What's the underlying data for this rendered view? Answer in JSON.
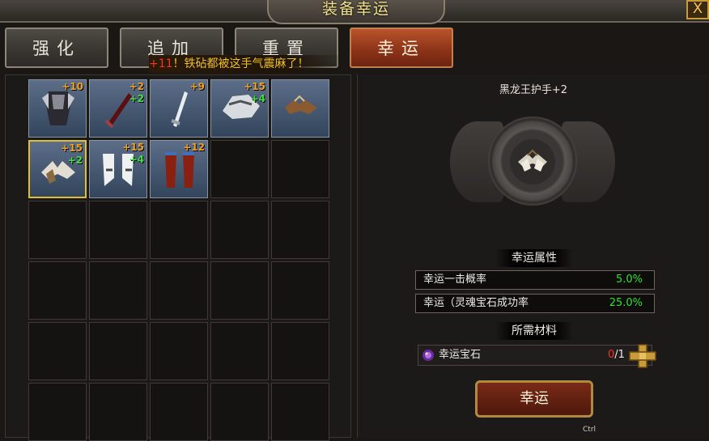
{
  "window": {
    "title": "装备幸运",
    "close_label": "X"
  },
  "tabs": [
    {
      "label": "强化",
      "active": false
    },
    {
      "label": "追加",
      "active": false
    },
    {
      "label": "重置",
      "active": false
    },
    {
      "label": "幸运",
      "active": true
    }
  ],
  "notice": {
    "prefix": "+11",
    "text": "！铁砧都被这手气震麻了！"
  },
  "inventory": {
    "slots": [
      {
        "item": "armor",
        "level": "+10",
        "bonus": ""
      },
      {
        "item": "dark-sword",
        "level": "+2",
        "bonus": "+2"
      },
      {
        "item": "white-sword",
        "level": "+9",
        "bonus": ""
      },
      {
        "item": "dragon-helm",
        "level": "+15",
        "bonus": "+4"
      },
      {
        "item": "gauntlets",
        "level": "",
        "bonus": ""
      },
      {
        "item": "gauntlets-selected",
        "level": "+15",
        "bonus": "+2"
      },
      {
        "item": "white-boots",
        "level": "+15",
        "bonus": "+4"
      },
      {
        "item": "red-pants",
        "level": "+12",
        "bonus": ""
      }
    ]
  },
  "selected_item": {
    "name": "黑龙王护手+2"
  },
  "luck_attributes": {
    "title": "幸运属性",
    "rows": [
      {
        "label": "幸运一击概率",
        "value": "5.0%"
      },
      {
        "label": "幸运（灵魂宝石成功率",
        "value": "25.0%"
      }
    ]
  },
  "materials": {
    "title": "所需材料",
    "items": [
      {
        "name": "幸运宝石",
        "have": "0",
        "need": "/1"
      }
    ]
  },
  "action": {
    "label": "幸运",
    "hotkey": "Ctrl"
  },
  "colors": {
    "accent_gold": "#e0c030",
    "value_green": "#30e030",
    "warning_red": "#ff3020"
  }
}
